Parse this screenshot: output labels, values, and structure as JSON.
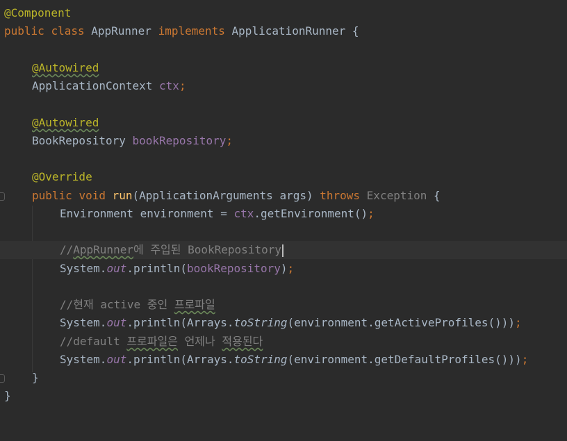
{
  "editor": {
    "language": "java",
    "lines": [
      {
        "tokens": [
          "@Component"
        ]
      },
      {
        "tokens": [
          "public",
          " ",
          "class",
          " AppRunner ",
          "implements",
          " ApplicationRunner {"
        ]
      },
      {
        "tokens": []
      },
      {
        "tokens": [
          "@Autowired"
        ]
      },
      {
        "tokens": [
          "ApplicationContext ",
          "ctx",
          ";"
        ]
      },
      {
        "tokens": []
      },
      {
        "tokens": [
          "@Autowired"
        ]
      },
      {
        "tokens": [
          "BookRepository ",
          "bookRepository",
          ";"
        ]
      },
      {
        "tokens": []
      },
      {
        "tokens": [
          "@Override"
        ]
      },
      {
        "tokens": [
          "public",
          " ",
          "void",
          " ",
          "run",
          "(ApplicationArguments args) ",
          "throws",
          " ",
          "Exception",
          " {"
        ]
      },
      {
        "tokens": [
          "Environment environment = ",
          "ctx",
          ".getEnvironment()",
          ";"
        ]
      },
      {
        "tokens": []
      },
      {
        "tokens": [
          "//",
          "AppRunner",
          "에 주입된 BookRepository"
        ]
      },
      {
        "tokens": [
          "System.",
          "out",
          ".println(",
          "bookRepository",
          ")",
          ";"
        ]
      },
      {
        "tokens": []
      },
      {
        "tokens": [
          "//현재 active 중인 ",
          "프로파일"
        ]
      },
      {
        "tokens": [
          "System.",
          "out",
          ".println(Arrays.",
          "toString",
          "(environment.getActiveProfiles()))",
          ";"
        ]
      },
      {
        "tokens": [
          "//default ",
          "프로파일은",
          " 언제나 ",
          "적용된다"
        ]
      },
      {
        "tokens": [
          "System.",
          "out",
          ".println(Arrays.",
          "toString",
          "(environment.getDefaultProfiles()))",
          ";"
        ]
      },
      {
        "tokens": [
          "}"
        ]
      },
      {
        "tokens": [
          "}"
        ]
      }
    ]
  },
  "colors": {
    "background": "#2b2b2b",
    "current_line": "#323232",
    "keyword": "#cc7832",
    "annotation": "#bbb529",
    "field": "#9876aa",
    "method_decl": "#ffc66d",
    "comment": "#808080",
    "text": "#a9b7c6"
  }
}
